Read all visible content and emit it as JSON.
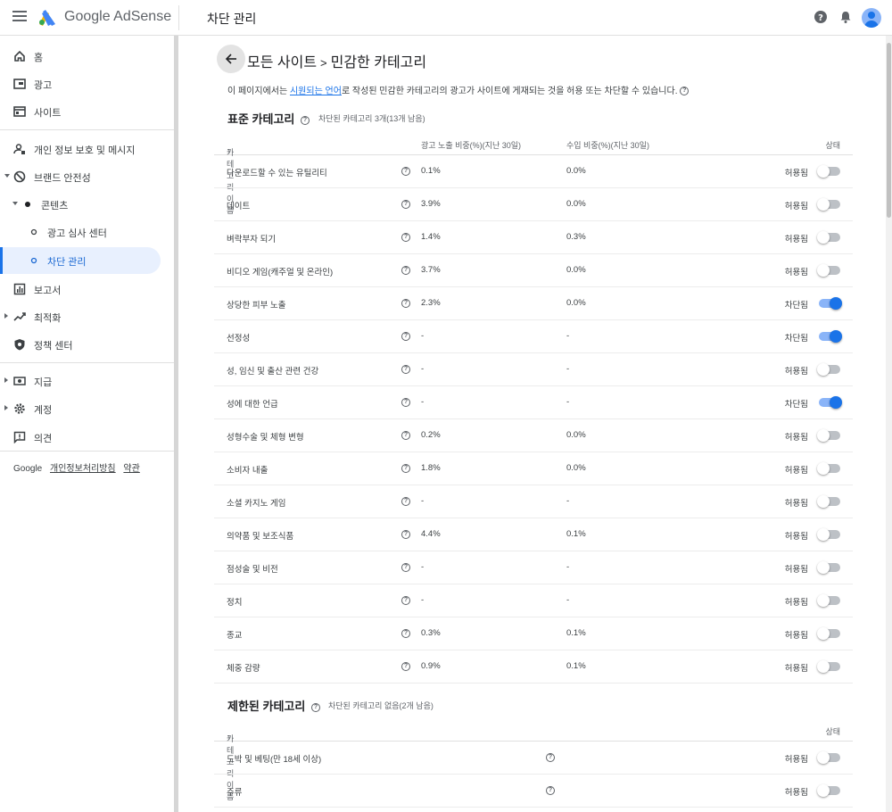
{
  "topbar": {
    "brand": "Google AdSense",
    "page_title": "차단 관리"
  },
  "sidebar": {
    "items": [
      {
        "label": "홈",
        "icon": "home-icon"
      },
      {
        "label": "광고",
        "icon": "ads-icon"
      },
      {
        "label": "사이트",
        "icon": "sites-icon"
      },
      {
        "label": "개인 정보 보호 및 메시지",
        "icon": "privacy-icon"
      },
      {
        "label": "브랜드 안전성",
        "icon": "block-icon"
      },
      {
        "label": "콘텐츠",
        "icon": "dot-icon"
      },
      {
        "label": "광고 심사 센터",
        "icon": "circle-icon"
      },
      {
        "label": "차단 관리",
        "icon": "circle-icon"
      },
      {
        "label": "보고서",
        "icon": "reports-icon"
      },
      {
        "label": "최적화",
        "icon": "trend-icon"
      },
      {
        "label": "정책 센터",
        "icon": "policy-icon"
      },
      {
        "label": "지급",
        "icon": "payments-icon"
      },
      {
        "label": "계정",
        "icon": "gear-icon"
      },
      {
        "label": "의견",
        "icon": "feedback-icon"
      }
    ],
    "footer": {
      "google": "Google",
      "privacy": "개인정보처리방침",
      "terms": "약관"
    }
  },
  "main": {
    "breadcrumb_root": "모든 사이트",
    "breadcrumb_sep": ">",
    "breadcrumb_current": "민감한 카테고리",
    "desc_prefix": "이 페이지에서는",
    "desc_link": "시원되는 언어",
    "desc_suffix": "로 작성된 민감한 카테고리의 광고가 사이트에 게재되는 것을 허용 또는 차단할 수 있습니다.",
    "standard": {
      "title": "표준 카테고리",
      "subtitle": "차단된 카테고리 3개(13개 남음)",
      "headers": {
        "name": "카테고리 이름",
        "impressions": "광고 노출 비중(%)(지난 30일)",
        "revenue": "수입 비중(%)(지난 30일)",
        "state": "상태"
      },
      "rows": [
        {
          "name": "다운로드할 수 있는 유틸리티",
          "imp": "0.1%",
          "rev": "0.0%",
          "state": "허용됨",
          "on": false
        },
        {
          "name": "데이트",
          "imp": "3.9%",
          "rev": "0.0%",
          "state": "허용됨",
          "on": false
        },
        {
          "name": "벼락부자 되기",
          "imp": "1.4%",
          "rev": "0.3%",
          "state": "허용됨",
          "on": false
        },
        {
          "name": "비디오 게임(캐주얼 및 온라인)",
          "imp": "3.7%",
          "rev": "0.0%",
          "state": "허용됨",
          "on": false
        },
        {
          "name": "상당한 피부 노출",
          "imp": "2.3%",
          "rev": "0.0%",
          "state": "차단됨",
          "on": true
        },
        {
          "name": "선정성",
          "imp": "-",
          "rev": "-",
          "state": "차단됨",
          "on": true
        },
        {
          "name": "성, 임신 및 출산 관련 건강",
          "imp": "-",
          "rev": "-",
          "state": "허용됨",
          "on": false
        },
        {
          "name": "성에 대한 언급",
          "imp": "-",
          "rev": "-",
          "state": "차단됨",
          "on": true
        },
        {
          "name": "성형수술 및 체형 변형",
          "imp": "0.2%",
          "rev": "0.0%",
          "state": "허용됨",
          "on": false
        },
        {
          "name": "소비자 내출",
          "imp": "1.8%",
          "rev": "0.0%",
          "state": "허용됨",
          "on": false
        },
        {
          "name": "소셜 카지노 게임",
          "imp": "-",
          "rev": "-",
          "state": "허용됨",
          "on": false
        },
        {
          "name": "의약품 및 보조식품",
          "imp": "4.4%",
          "rev": "0.1%",
          "state": "허용됨",
          "on": false
        },
        {
          "name": "점성술 및 비전",
          "imp": "-",
          "rev": "-",
          "state": "허용됨",
          "on": false
        },
        {
          "name": "정치",
          "imp": "-",
          "rev": "-",
          "state": "허용됨",
          "on": false
        },
        {
          "name": "종교",
          "imp": "0.3%",
          "rev": "0.1%",
          "state": "허용됨",
          "on": false
        },
        {
          "name": "체중 감량",
          "imp": "0.9%",
          "rev": "0.1%",
          "state": "허용됨",
          "on": false
        }
      ]
    },
    "restricted": {
      "title": "제한된 카테고리",
      "subtitle": "차단된 카테고리 없음(2개 남음)",
      "headers": {
        "name": "카테고리 이름",
        "state": "상태"
      },
      "rows": [
        {
          "name": "도박 및 베팅(만 18세 이상)",
          "state": "허용됨",
          "on": false
        },
        {
          "name": "주류",
          "state": "허용됨",
          "on": false
        }
      ]
    }
  }
}
